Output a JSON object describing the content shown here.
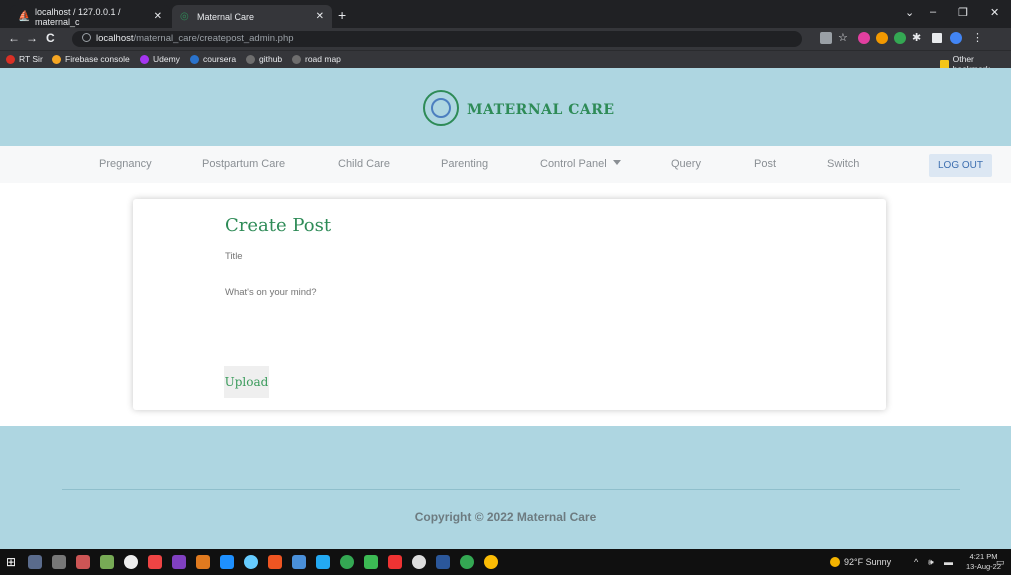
{
  "browser": {
    "tabs": [
      {
        "label": "localhost / 127.0.0.1 / maternal_c",
        "icon": "phpmyadmin-icon"
      },
      {
        "label": "Maternal Care",
        "icon": "site-favicon"
      }
    ],
    "new_tab": "+",
    "window_controls": {
      "minimize": "–",
      "restore": "❐",
      "close": "✕",
      "tab_search": "⌄"
    },
    "nav": {
      "back": "←",
      "forward": "→",
      "reload": "C"
    },
    "url_host": "localhost",
    "url_path": "/maternal_care/createpost_admin.php",
    "bookmarks": [
      {
        "label": "RT Sir",
        "color": "#d93025"
      },
      {
        "label": "Firebase console",
        "color": "#f5a623"
      },
      {
        "label": "Udemy",
        "color": "#a435f0"
      },
      {
        "label": "coursera",
        "color": "#2a73cc"
      },
      {
        "label": "github",
        "color": "#6e6e6e"
      },
      {
        "label": "road map",
        "color": "#6e6e6e"
      }
    ],
    "other_bookmarks": "Other bookmark"
  },
  "site": {
    "brand": "MATERNAL CARE",
    "nav_items": [
      "Pregnancy",
      "Postpartum Care",
      "Child Care",
      "Parenting",
      "Control Panel",
      "Query",
      "Post",
      "Switch"
    ],
    "logout": "LOG OUT"
  },
  "form": {
    "heading": "Create Post",
    "title_placeholder": "Title",
    "body_placeholder": "What's on your mind?",
    "upload_label": "Upload"
  },
  "footer": {
    "copyright": "Copyright © 2022 Maternal Care"
  },
  "taskbar": {
    "weather": "92°F Sunny",
    "time": "4:21 PM",
    "date": "13-Aug-22"
  },
  "colors": {
    "brand_bg": "#aed6e1",
    "brand_green": "#2e8b57",
    "logout_bg": "#dce7f3"
  }
}
